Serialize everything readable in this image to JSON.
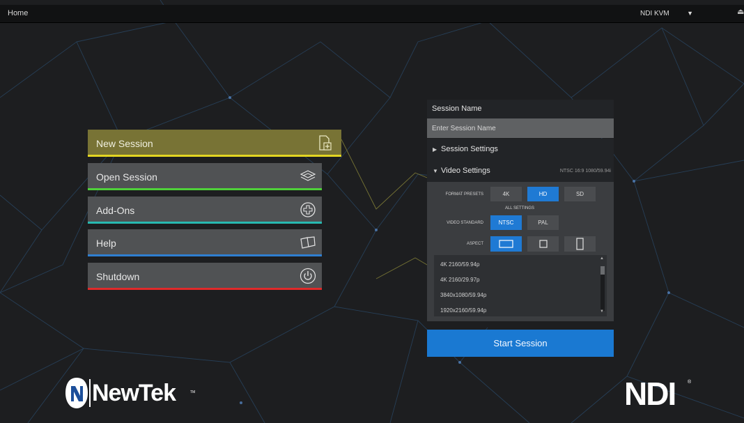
{
  "topbar": {
    "title": "Home",
    "dropdown_value": "NDI KVM",
    "dropdown_caret": "▼",
    "eject_icon": "⏏"
  },
  "menu": {
    "items": [
      {
        "label": "New Session",
        "icon": "new-document-icon",
        "accent": "#e3d522"
      },
      {
        "label": "Open Session",
        "icon": "open-stack-icon",
        "accent": "#4fd13a"
      },
      {
        "label": "Add-Ons",
        "icon": "plus-circle-icon",
        "accent": "#28b9b1"
      },
      {
        "label": "Help",
        "icon": "book-icon",
        "accent": "#2f7fd1"
      },
      {
        "label": "Shutdown",
        "icon": "power-icon",
        "accent": "#e02a2a"
      }
    ]
  },
  "session": {
    "title": "Session Name",
    "placeholder": "Enter Session Name",
    "session_settings": {
      "arrow": "▶",
      "label": "Session Settings"
    },
    "video_settings": {
      "arrow": "▼",
      "label": "Video Settings",
      "summary": "NTSC 16:9 1080/59.94i"
    },
    "format_presets_label": "FORMAT PRESETS",
    "format_presets": [
      {
        "label": "4K",
        "selected": false
      },
      {
        "label": "HD",
        "selected": true
      },
      {
        "label": "SD",
        "selected": false
      }
    ],
    "all_settings_label": "ALL SETTINGS",
    "video_standard_label": "VIDEO STANDARD",
    "video_standards": [
      {
        "label": "NTSC",
        "selected": true
      },
      {
        "label": "PAL",
        "selected": false
      }
    ],
    "aspect_label": "ASPECT",
    "aspect_options": [
      {
        "icon": "widescreen-icon",
        "selected": true
      },
      {
        "icon": "square-icon",
        "selected": false
      },
      {
        "icon": "portrait-icon",
        "selected": false
      }
    ],
    "resolutions": [
      "4K 2160/59.94p",
      "4K 2160/29.97p",
      "3840x1080/59.94p",
      "1920x2160/59.94p"
    ],
    "scroll_up": "▲",
    "scroll_down": "▼",
    "start_label": "Start Session"
  },
  "logos": {
    "newtek": "NewTek",
    "newtek_tm": "TM",
    "ndi": "NDI",
    "ndi_r": "®"
  },
  "colors": {
    "accent_blue": "#1a79d2",
    "background": "#1d1e20"
  }
}
